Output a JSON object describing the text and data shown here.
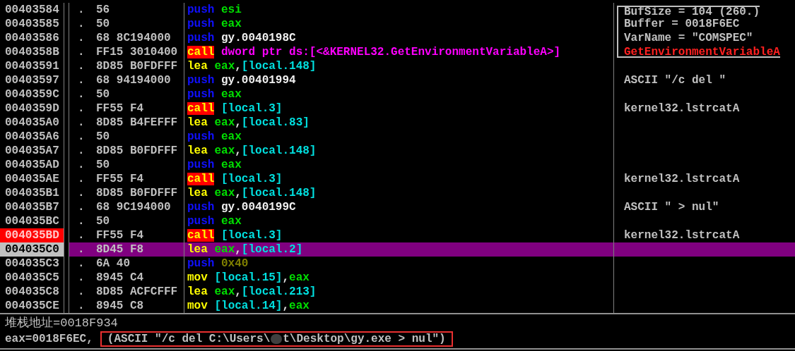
{
  "disassembly": {
    "rows": [
      {
        "address": "00403584",
        "marker": ".",
        "hex": "56",
        "mnemonic": {
          "text": "push",
          "kind": "push"
        },
        "operands": [
          {
            "text": "esi",
            "kind": "reg"
          }
        ],
        "comment": {
          "text": "BufSize = 104 (260.)",
          "kind": "arg_start"
        },
        "breakpoint": false,
        "selected": false
      },
      {
        "address": "00403585",
        "marker": ".",
        "hex": "50",
        "mnemonic": {
          "text": "push",
          "kind": "push"
        },
        "operands": [
          {
            "text": "eax",
            "kind": "reg"
          }
        ],
        "comment": {
          "text": "Buffer = 0018F6EC",
          "kind": "arg"
        },
        "breakpoint": false,
        "selected": false
      },
      {
        "address": "00403586",
        "marker": ".",
        "hex": "68 8C194000",
        "mnemonic": {
          "text": "push",
          "kind": "push"
        },
        "operands": [
          {
            "text": "gy.0040198C",
            "kind": "addr"
          }
        ],
        "comment": {
          "text": "VarName = \"COMSPEC\"",
          "kind": "arg"
        },
        "breakpoint": false,
        "selected": false
      },
      {
        "address": "0040358B",
        "marker": ".",
        "hex": "FF15 3010400",
        "mnemonic": {
          "text": "call",
          "kind": "call"
        },
        "operands": [
          {
            "text": "dword ptr ds:[<&KERNEL32.GetEnvironmentVariableA>]",
            "kind": "api"
          }
        ],
        "comment": {
          "text": "GetEnvironmentVariableA",
          "kind": "call_end"
        },
        "breakpoint": false,
        "selected": false
      },
      {
        "address": "00403591",
        "marker": ".",
        "hex": "8D85 B0FDFFF",
        "mnemonic": {
          "text": "lea",
          "kind": "op"
        },
        "operands": [
          {
            "text": "eax",
            "kind": "reg"
          },
          {
            "text": ",",
            "kind": "punct"
          },
          {
            "text": "[local.148]",
            "kind": "mem"
          }
        ],
        "breakpoint": false,
        "selected": false
      },
      {
        "address": "00403597",
        "marker": ".",
        "hex": "68 94194000",
        "mnemonic": {
          "text": "push",
          "kind": "push"
        },
        "operands": [
          {
            "text": "gy.00401994",
            "kind": "addr"
          }
        ],
        "comment": {
          "text": "ASCII \"/c del \"",
          "kind": "plain"
        },
        "breakpoint": false,
        "selected": false
      },
      {
        "address": "0040359C",
        "marker": ".",
        "hex": "50",
        "mnemonic": {
          "text": "push",
          "kind": "push"
        },
        "operands": [
          {
            "text": "eax",
            "kind": "reg"
          }
        ],
        "breakpoint": false,
        "selected": false
      },
      {
        "address": "0040359D",
        "marker": ".",
        "hex": "FF55 F4",
        "mnemonic": {
          "text": "call",
          "kind": "call"
        },
        "operands": [
          {
            "text": "[local.3]",
            "kind": "mem"
          }
        ],
        "comment": {
          "text": "kernel32.lstrcatA",
          "kind": "plain"
        },
        "breakpoint": false,
        "selected": false
      },
      {
        "address": "004035A0",
        "marker": ".",
        "hex": "8D85 B4FEFFF",
        "mnemonic": {
          "text": "lea",
          "kind": "op"
        },
        "operands": [
          {
            "text": "eax",
            "kind": "reg"
          },
          {
            "text": ",",
            "kind": "punct"
          },
          {
            "text": "[local.83]",
            "kind": "mem"
          }
        ],
        "breakpoint": false,
        "selected": false
      },
      {
        "address": "004035A6",
        "marker": ".",
        "hex": "50",
        "mnemonic": {
          "text": "push",
          "kind": "push"
        },
        "operands": [
          {
            "text": "eax",
            "kind": "reg"
          }
        ],
        "breakpoint": false,
        "selected": false
      },
      {
        "address": "004035A7",
        "marker": ".",
        "hex": "8D85 B0FDFFF",
        "mnemonic": {
          "text": "lea",
          "kind": "op"
        },
        "operands": [
          {
            "text": "eax",
            "kind": "reg"
          },
          {
            "text": ",",
            "kind": "punct"
          },
          {
            "text": "[local.148]",
            "kind": "mem"
          }
        ],
        "breakpoint": false,
        "selected": false
      },
      {
        "address": "004035AD",
        "marker": ".",
        "hex": "50",
        "mnemonic": {
          "text": "push",
          "kind": "push"
        },
        "operands": [
          {
            "text": "eax",
            "kind": "reg"
          }
        ],
        "breakpoint": false,
        "selected": false
      },
      {
        "address": "004035AE",
        "marker": ".",
        "hex": "FF55 F4",
        "mnemonic": {
          "text": "call",
          "kind": "call"
        },
        "operands": [
          {
            "text": "[local.3]",
            "kind": "mem"
          }
        ],
        "comment": {
          "text": "kernel32.lstrcatA",
          "kind": "plain"
        },
        "breakpoint": false,
        "selected": false
      },
      {
        "address": "004035B1",
        "marker": ".",
        "hex": "8D85 B0FDFFF",
        "mnemonic": {
          "text": "lea",
          "kind": "op"
        },
        "operands": [
          {
            "text": "eax",
            "kind": "reg"
          },
          {
            "text": ",",
            "kind": "punct"
          },
          {
            "text": "[local.148]",
            "kind": "mem"
          }
        ],
        "breakpoint": false,
        "selected": false
      },
      {
        "address": "004035B7",
        "marker": ".",
        "hex": "68 9C194000",
        "mnemonic": {
          "text": "push",
          "kind": "push"
        },
        "operands": [
          {
            "text": "gy.0040199C",
            "kind": "addr"
          }
        ],
        "comment": {
          "text": "ASCII \" > nul\"",
          "kind": "plain"
        },
        "breakpoint": false,
        "selected": false
      },
      {
        "address": "004035BC",
        "marker": ".",
        "hex": "50",
        "mnemonic": {
          "text": "push",
          "kind": "push"
        },
        "operands": [
          {
            "text": "eax",
            "kind": "reg"
          }
        ],
        "breakpoint": false,
        "selected": false
      },
      {
        "address": "004035BD",
        "marker": ".",
        "hex": "FF55 F4",
        "mnemonic": {
          "text": "call",
          "kind": "call"
        },
        "operands": [
          {
            "text": "[local.3]",
            "kind": "mem"
          }
        ],
        "comment": {
          "text": "kernel32.lstrcatA",
          "kind": "plain"
        },
        "breakpoint": true,
        "selected": false
      },
      {
        "address": "004035C0",
        "marker": ".",
        "hex": "8D45 F8",
        "mnemonic": {
          "text": "lea",
          "kind": "op"
        },
        "operands": [
          {
            "text": "eax",
            "kind": "reg"
          },
          {
            "text": ",",
            "kind": "punct"
          },
          {
            "text": "[local.2]",
            "kind": "mem"
          }
        ],
        "breakpoint": false,
        "selected": true
      },
      {
        "address": "004035C3",
        "marker": ".",
        "hex": "6A 40",
        "mnemonic": {
          "text": "push",
          "kind": "push"
        },
        "operands": [
          {
            "text": "0x40",
            "kind": "imm"
          }
        ],
        "breakpoint": false,
        "selected": false
      },
      {
        "address": "004035C5",
        "marker": ".",
        "hex": "8945 C4",
        "mnemonic": {
          "text": "mov",
          "kind": "op"
        },
        "operands": [
          {
            "text": "[local.15]",
            "kind": "mem"
          },
          {
            "text": ",",
            "kind": "punct"
          },
          {
            "text": "eax",
            "kind": "reg"
          }
        ],
        "breakpoint": false,
        "selected": false
      },
      {
        "address": "004035C8",
        "marker": ".",
        "hex": "8D85 ACFCFFF",
        "mnemonic": {
          "text": "lea",
          "kind": "op"
        },
        "operands": [
          {
            "text": "eax",
            "kind": "reg"
          },
          {
            "text": ",",
            "kind": "punct"
          },
          {
            "text": "[local.213]",
            "kind": "mem"
          }
        ],
        "breakpoint": false,
        "selected": false
      },
      {
        "address": "004035CE",
        "marker": ".",
        "hex": "8945 C8",
        "mnemonic": {
          "text": "mov",
          "kind": "op"
        },
        "operands": [
          {
            "text": "[local.14]",
            "kind": "mem"
          },
          {
            "text": ",",
            "kind": "punct"
          },
          {
            "text": "eax",
            "kind": "reg"
          }
        ],
        "breakpoint": false,
        "selected": false
      }
    ]
  },
  "info_pane": {
    "stack_line": "堆栈地址=0018F934",
    "register": "eax=0018F6EC,",
    "highlight_before": "(ASCII \"/c del C:\\Users\\",
    "highlight_after": "t\\Desktop\\gy.exe > nul\")"
  }
}
